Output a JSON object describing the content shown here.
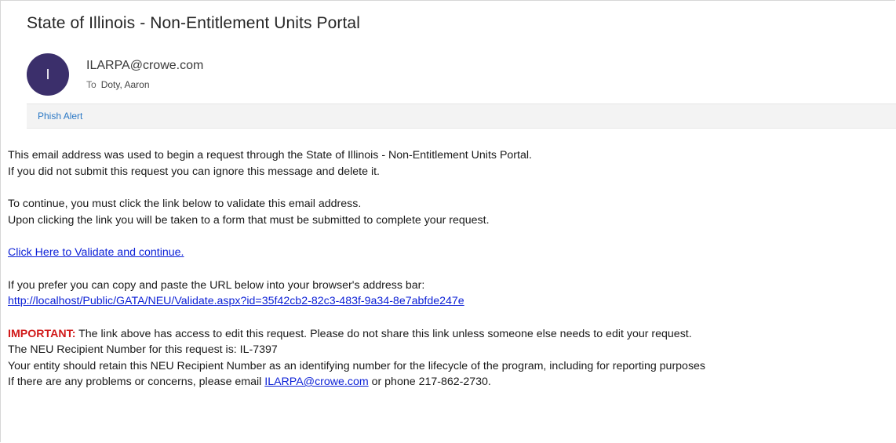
{
  "email": {
    "subject": "State of Illinois - Non-Entitlement Units Portal",
    "avatar_initial": "I",
    "sender": "ILARPA@crowe.com",
    "to_label": "To",
    "to_name": "Doty, Aaron"
  },
  "toolbar": {
    "phish_alert_label": "Phish Alert"
  },
  "message": {
    "line1": "This email address was used to begin a request through the State of Illinois - Non-Entitlement Units Portal.",
    "line2": "If you did not submit this request you can ignore this message and delete it.",
    "line3": "To continue, you must click the link below to validate this email address.",
    "line4": "Upon clicking the link you will be taken to a form that must be submitted to complete your request.",
    "validate_link": "Click Here to Validate and continue.",
    "line5": "If you prefer you can copy and paste the URL below into your browser's address bar:",
    "url": "http://localhost/Public/GATA/NEU/Validate.aspx?id=35f42cb2-82c3-483f-9a34-8e7abfde247e",
    "important_label": "IMPORTANT:",
    "important_text": " The link above has access to edit this request. Please do not share this link unless someone else needs to edit your request.",
    "recipient_line": "The NEU Recipient Number for this request is: IL-7397",
    "retain_line": "Your entity should retain this NEU Recipient Number as an identifying number for the lifecycle of the program, including for reporting purposes",
    "contact_prefix": "If there are any problems or concerns, please email ",
    "contact_email": "ILARPA@crowe.com",
    "contact_suffix": " or phone 217-862-2730."
  },
  "colors": {
    "avatar_bg": "#3b2f6b",
    "link": "#0b1fd6",
    "important": "#d11a1a",
    "phish_alert": "#2b78c5"
  }
}
